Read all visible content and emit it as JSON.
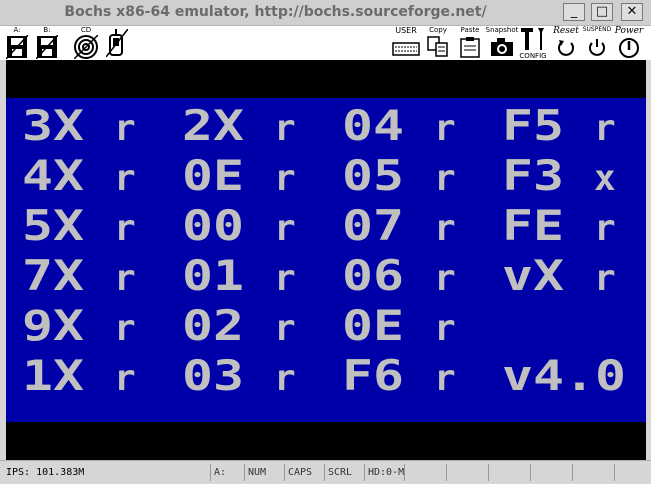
{
  "window": {
    "title": "Bochs x86-64 emulator, http://bochs.sourceforge.net/",
    "minimize_label": "_",
    "maximize_label": "□",
    "close_label": "✕"
  },
  "toolbar": {
    "floppy_a_label": "A:",
    "floppy_b_label": "B:",
    "cdrom_label": "CD",
    "user_label": "USER",
    "copy_label": "Copy",
    "paste_label": "Paste",
    "snapshot_label": "Snapshot",
    "config_label": "CONFIG",
    "reset_label": "Reset",
    "suspend_label": "SUSPEND",
    "power_label": "Power"
  },
  "screen": {
    "colors": {
      "background": "#000000",
      "panel": "#0000a8",
      "text": "#c0c0c0"
    },
    "rows": [
      [
        "3X",
        "r",
        "2X",
        "r",
        "04",
        "r",
        "F5",
        "r"
      ],
      [
        "4X",
        "r",
        "0E",
        "r",
        "05",
        "r",
        "F3",
        "x"
      ],
      [
        "5X",
        "r",
        "00",
        "r",
        "07",
        "r",
        "FE",
        "r"
      ],
      [
        "7X",
        "r",
        "01",
        "r",
        "06",
        "r",
        "vX",
        "r"
      ],
      [
        "9X",
        "r",
        "02",
        "r",
        "0E",
        "r",
        "",
        ""
      ],
      [
        "1X",
        "r",
        "03",
        "r",
        "F6",
        "r",
        "v4.0",
        ""
      ]
    ]
  },
  "statusbar": {
    "ips": "IPS: 101.383M",
    "drive": "A:",
    "num": "NUM",
    "caps": "CAPS",
    "scrl": "SCRL",
    "hd": "HD:0-M",
    "empty": ""
  }
}
